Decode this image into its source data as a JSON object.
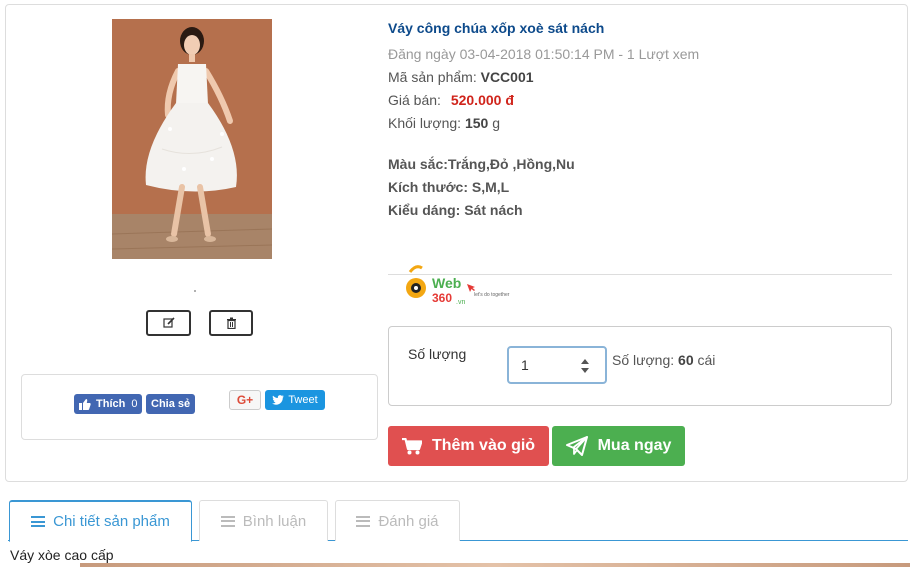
{
  "product": {
    "title": "Váy công chúa xốp xoè sát nách",
    "posted": "Đăng ngày 03-04-2018 01:50:14 PM - 1 Lượt xem",
    "sku_label": "Mã sản phẩm:",
    "sku": "VCC001",
    "price_label": "Giá bán:",
    "price": "520.000 đ",
    "weight_label": "Khối lượng:",
    "weight": "150",
    "weight_unit": "g",
    "color_line": "Màu sắc:Trắng,Đỏ ,Hồng,Nu",
    "size_line": "Kích thước: S,M,L",
    "style_line": "Kiểu dáng: Sát nách",
    "image_alt": "Váy công chúa xốp xoè sát nách"
  },
  "admin": {
    "edit_icon": "edit-icon",
    "delete_icon": "trash-icon"
  },
  "social": {
    "like_label": "Thích",
    "like_count": "0",
    "share_label": "Chia sẻ",
    "gplus_label": "G+",
    "tweet_label": "Tweet"
  },
  "logo": {
    "brand": "Web",
    "brand2": "360",
    "tld": ".vn",
    "tagline": "let's do together"
  },
  "order": {
    "qty_label": "Số lượng",
    "qty_value": "1",
    "stock_label": "Số lượng:",
    "stock_value": "60",
    "stock_unit": "cái",
    "add_to_cart": "Thêm vào giỏ",
    "buy_now": "Mua ngay"
  },
  "tabs": [
    {
      "label": "Chi tiết sản phẩm"
    },
    {
      "label": "Bình luận"
    },
    {
      "label": "Đánh giá"
    }
  ],
  "description": "Váy xòe cao cấp",
  "colors": {
    "title": "#0d4a8b",
    "price": "#d0241b",
    "cart_button": "#e05050",
    "buy_button": "#4caf50",
    "tab_active": "#3a97d4",
    "facebook": "#4267b2",
    "twitter": "#1b95e0"
  }
}
